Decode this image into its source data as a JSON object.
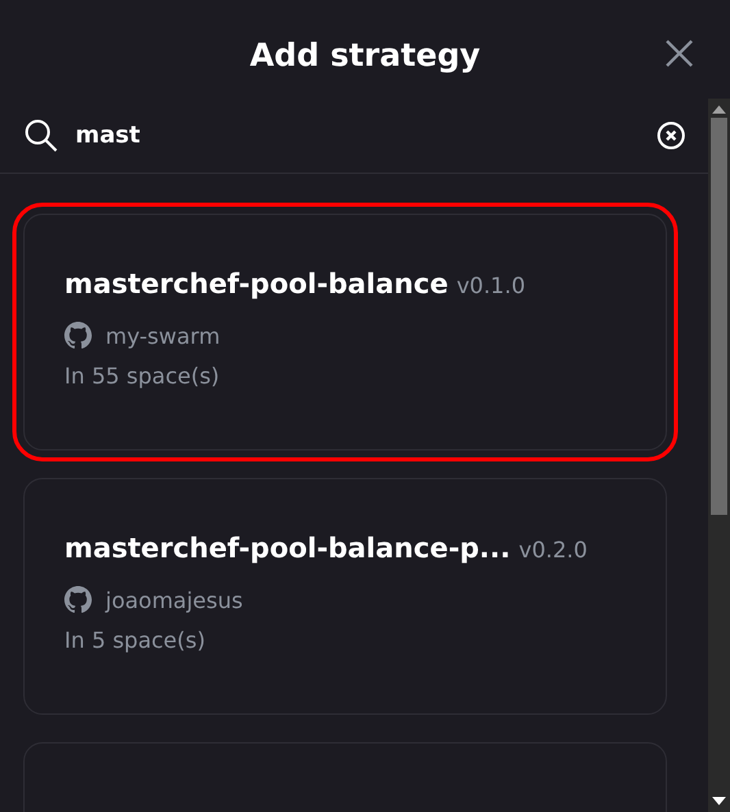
{
  "dialog": {
    "title": "Add strategy"
  },
  "search": {
    "value": "mast"
  },
  "strategies": [
    {
      "name": "masterchef-pool-balance",
      "version": "v0.1.0",
      "author": "my-swarm",
      "spaces": "In 55 space(s)",
      "selected": true
    },
    {
      "name": "masterchef-pool-balance-p...",
      "version": "v0.2.0",
      "author": "joaomajesus",
      "spaces": "In 5 space(s)",
      "selected": false
    },
    {
      "selected": false
    }
  ]
}
